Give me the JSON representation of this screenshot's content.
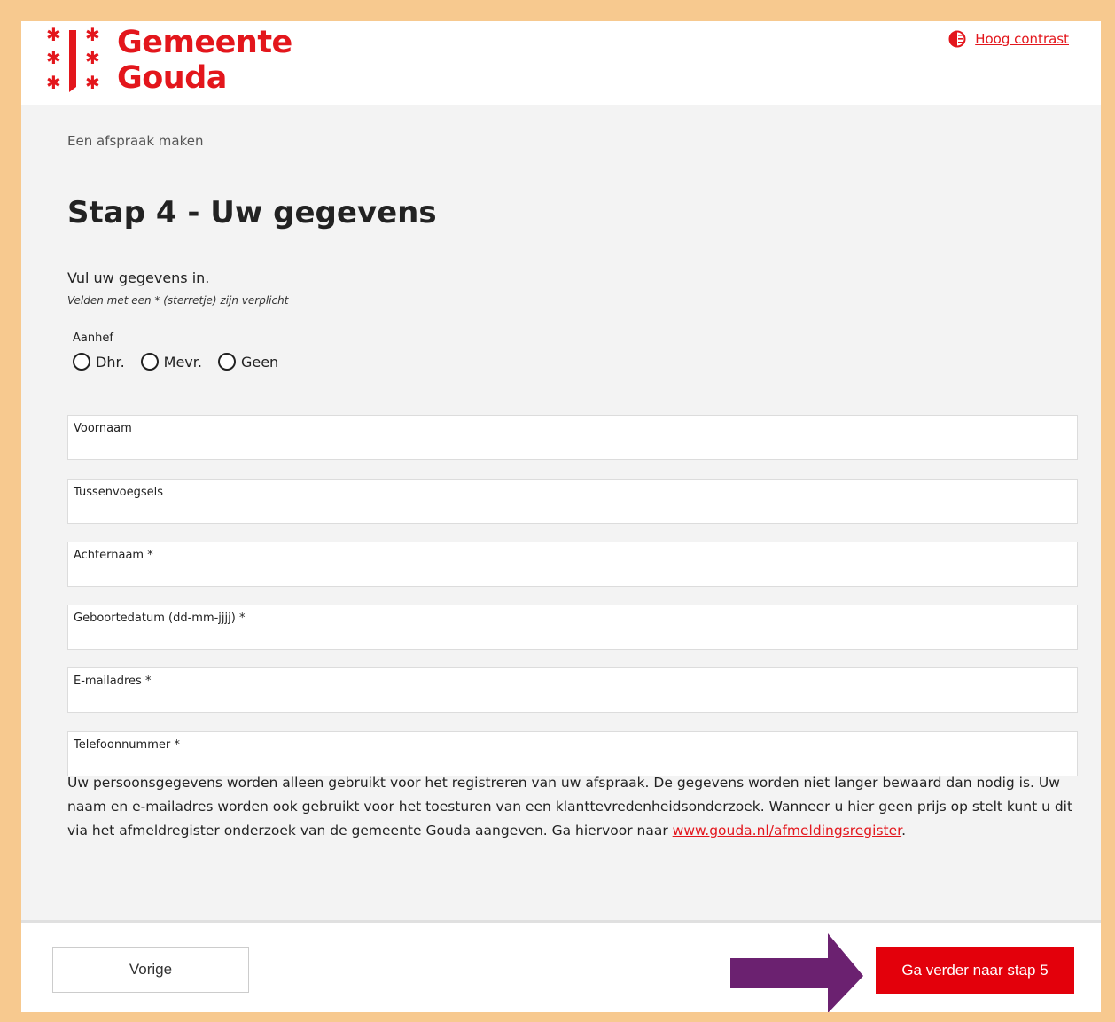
{
  "header": {
    "logo_line1": "Gemeente",
    "logo_line2": "Gouda",
    "high_contrast_label": "Hoog contrast"
  },
  "breadcrumb": "Een afspraak maken",
  "page_title": "Stap 4 - Uw gegevens",
  "intro": "Vul uw gegevens in.",
  "required_hint": "Velden met een * (sterretje) zijn verplicht",
  "aanhef": {
    "label": "Aanhef",
    "options": [
      "Dhr.",
      "Mevr.",
      "Geen"
    ]
  },
  "fields": [
    {
      "label": "Voornaam",
      "value": ""
    },
    {
      "label": "Tussenvoegsels",
      "value": ""
    },
    {
      "label": "Achternaam *",
      "value": ""
    },
    {
      "label": "Geboortedatum (dd-mm-jjjj) *",
      "value": ""
    },
    {
      "label": "E-mailadres *",
      "value": ""
    },
    {
      "label": "Telefoonnummer *",
      "value": ""
    }
  ],
  "privacy": {
    "text": "Uw persoonsgegevens worden alleen gebruikt voor het registreren van uw afspraak. De gegevens worden niet langer bewaard dan nodig is. Uw naam en e-mailadres worden ook gebruikt voor het toesturen van een klanttevredenheidsonderzoek. Wanneer u hier geen prijs op stelt kunt u dit via het afmeldregister onderzoek van de gemeente Gouda aangeven. Ga hiervoor naar ",
    "link": "www.gouda.nl/afmeldingsregister",
    "suffix": "."
  },
  "footer": {
    "prev_label": "Vorige",
    "next_label": "Ga verder naar stap 5"
  },
  "colors": {
    "brand_red": "#e3161c",
    "button_red": "#e3000b",
    "annotation_arrow": "#6b2170",
    "frame": "#f7c98f"
  }
}
